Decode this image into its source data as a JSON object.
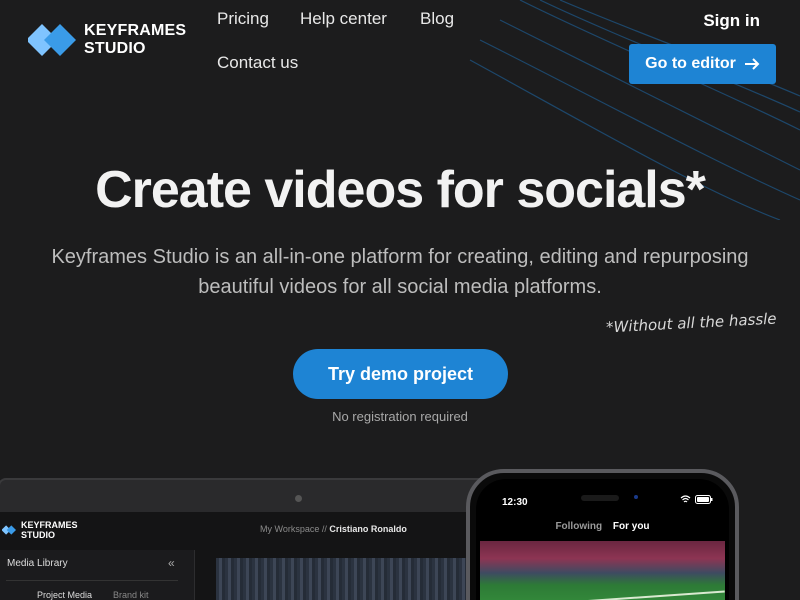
{
  "brand": {
    "line1": "KEYFRAMES",
    "line2": "STUDIO"
  },
  "nav": {
    "items": [
      {
        "label": "Pricing"
      },
      {
        "label": "Help center"
      },
      {
        "label": "Blog"
      },
      {
        "label": "Contact us"
      }
    ],
    "signin": "Sign in",
    "editor_button": "Go to editor"
  },
  "hero": {
    "title": "Create videos for socials*",
    "subtitle": "Keyframes Studio is an all-in-one platform for creating, editing and repurposing beautiful videos for all social media platforms.",
    "handwritten": "*Without all the hassle",
    "cta": "Try demo project",
    "cta_note": "No registration required"
  },
  "editor_mockup": {
    "brand_line1": "KEYFRAMES",
    "brand_line2": "STUDIO",
    "breadcrumb_workspace": "My Workspace //",
    "breadcrumb_project": "Cristiano Ronaldo",
    "media_library": "Media Library",
    "collapse_icon": "«",
    "tabs": [
      "Project Media",
      "Brand kit"
    ]
  },
  "phone_mockup": {
    "time": "12:30",
    "tab_following": "Following",
    "tab_foryou": "For you"
  },
  "colors": {
    "background": "#1c1c1d",
    "accent": "#1e84d4",
    "logo_light": "#7fc4ff",
    "logo_dark": "#3a9be8"
  },
  "icons": {
    "logo": "diamond-logo-icon",
    "arrow": "arrow-right-icon",
    "wifi": "wifi-icon",
    "battery": "battery-icon"
  }
}
